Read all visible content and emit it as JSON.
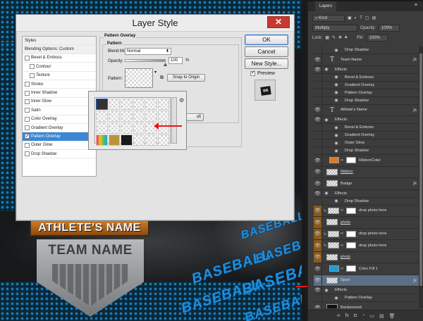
{
  "artwork": {
    "athlete_banner": "ATHLETE'S NAME",
    "team_banner": "TEAM NAME",
    "watermark": "BASEBALL",
    "colors": {
      "accent_blue": "#1d8fe0",
      "ribbon_orange": "#d07a22"
    }
  },
  "dialog": {
    "title": "Layer Style",
    "close_label": "✕",
    "styles": [
      {
        "label": "Styles",
        "kind": "head",
        "checkbox": false
      },
      {
        "label": "Blending Options: Custom",
        "kind": "head",
        "checkbox": false
      },
      {
        "label": "Bevel & Emboss",
        "kind": "item",
        "checkbox": true,
        "checked": false
      },
      {
        "label": "Contour",
        "kind": "sub",
        "checkbox": true,
        "checked": false
      },
      {
        "label": "Texture",
        "kind": "sub",
        "checkbox": true,
        "checked": false
      },
      {
        "label": "Stroke",
        "kind": "item",
        "checkbox": true,
        "checked": false
      },
      {
        "label": "Inner Shadow",
        "kind": "item",
        "checkbox": true,
        "checked": false
      },
      {
        "label": "Inner Glow",
        "kind": "item",
        "checkbox": true,
        "checked": false
      },
      {
        "label": "Satin",
        "kind": "item",
        "checkbox": true,
        "checked": false
      },
      {
        "label": "Color Overlay",
        "kind": "item",
        "checkbox": true,
        "checked": false
      },
      {
        "label": "Gradient Overlay",
        "kind": "item",
        "checkbox": true,
        "checked": false
      },
      {
        "label": "Pattern Overlay",
        "kind": "item",
        "checkbox": true,
        "checked": true,
        "selected": true
      },
      {
        "label": "Outer Glow",
        "kind": "item",
        "checkbox": true,
        "checked": false
      },
      {
        "label": "Drop Shadow",
        "kind": "item",
        "checkbox": true,
        "checked": false
      }
    ],
    "section_title": "Pattern Overlay",
    "subsection_title": "Pattern",
    "blend_mode_label": "Blend Mode:",
    "blend_mode_value": "Normal",
    "opacity_label": "Opacity:",
    "opacity_value": "100",
    "opacity_unit": "%",
    "opacity_level": 1.0,
    "pattern_label": "Pattern:",
    "snap_button": "Snap to Origin",
    "default_button_partial": "ult",
    "ok_button": "OK",
    "cancel_button": "Cancel",
    "new_style_button": "New Style...",
    "preview_label": "Preview",
    "preview_checked": true,
    "picker_gear": "⚙"
  },
  "layers_panel": {
    "tab": "Layers",
    "menu_icon": "≡",
    "kind_label": "Kind",
    "blend_mode": "Multiply",
    "opacity_label": "Opacity:",
    "opacity_value": "100%",
    "lock_label": "Lock:",
    "fill_label": "Fill:",
    "fill_value": "100%",
    "rows": [
      {
        "name": "Drop Shadow",
        "level": 2
      },
      {
        "name": "Team Name",
        "type": "text",
        "fx": true
      },
      {
        "name": "Effects",
        "level": 1
      },
      {
        "name": "Bevel & Emboss",
        "level": 2
      },
      {
        "name": "Gradient Overlay",
        "level": 2
      },
      {
        "name": "Pattern Overlay",
        "level": 2
      },
      {
        "name": "Drop Shadow",
        "level": 2
      },
      {
        "name": "Athlete's Name",
        "type": "text",
        "fx": true
      },
      {
        "name": "Effects",
        "level": 1
      },
      {
        "name": "Bevel & Emboss",
        "level": 2
      },
      {
        "name": "Gradient Overlay",
        "level": 2
      },
      {
        "name": "Outer Glow",
        "level": 2
      },
      {
        "name": "Drop Shadow",
        "level": 2
      },
      {
        "name": "RibbonColor",
        "type": "fill",
        "fill": "#e07a1e"
      },
      {
        "name": "Ribbon",
        "type": "pixel",
        "underline": true
      },
      {
        "name": "Badge",
        "type": "pixel",
        "fx": true
      },
      {
        "name": "Effects",
        "level": 1
      },
      {
        "name": "Drop Shadow",
        "level": 2
      },
      {
        "name": "drop photo here",
        "type": "clip",
        "orange": true
      },
      {
        "name": "photo",
        "type": "pixel",
        "orange": true,
        "underline": true
      },
      {
        "name": "drop photo here",
        "type": "clip",
        "orange": true
      },
      {
        "name": "drop photo here",
        "type": "clip",
        "orange": true
      },
      {
        "name": "photo",
        "type": "pixel",
        "orange": true,
        "underline": true
      },
      {
        "name": "Color Fill 1",
        "type": "fill",
        "fill": "#1e9fd6"
      },
      {
        "name": "Sport",
        "type": "pixel",
        "fx": true,
        "selected": true
      },
      {
        "name": "Effects",
        "level": 1
      },
      {
        "name": "Pattern Overlay",
        "level": 2
      },
      {
        "name": "Background",
        "type": "dark"
      }
    ],
    "footer_icons": [
      "∞",
      "fx",
      "◘",
      "◔",
      "▭",
      "▤",
      "🗑"
    ]
  }
}
